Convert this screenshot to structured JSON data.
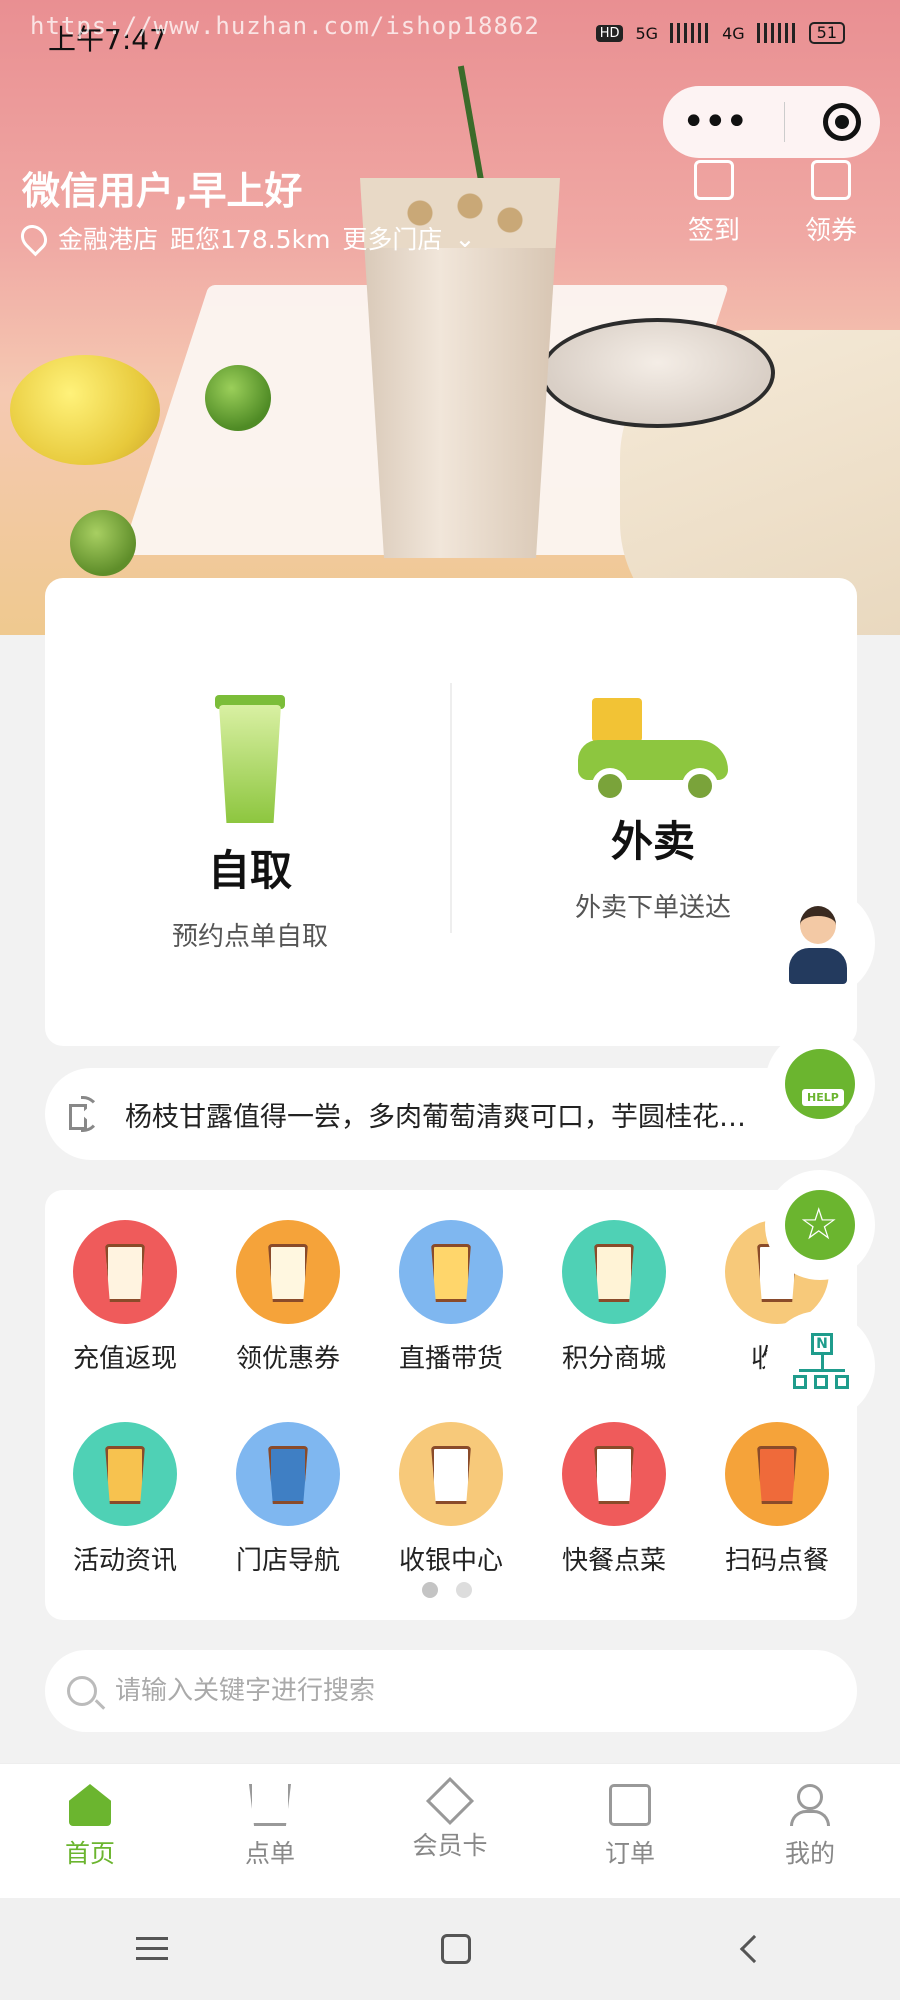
{
  "status_bar": {
    "time": "上午7:47",
    "network_5g": "5G",
    "network_4g": "4G",
    "hd": "HD",
    "battery": "51"
  },
  "watermark": "https://www.huzhan.com/ishop18862",
  "header": {
    "greeting": "微信用户,早上好",
    "store_name": "金融港店",
    "distance": "距您178.5km",
    "more_stores": "更多门店",
    "checkin_label": "签到",
    "coupon_label": "领券"
  },
  "order_options": [
    {
      "title": "自取",
      "subtitle": "预约点单自取",
      "icon": "pickup-cup-icon"
    },
    {
      "title": "外卖",
      "subtitle": "外卖下单送达",
      "icon": "delivery-scooter-icon"
    }
  ],
  "notice": {
    "text": "杨枝甘露值得一尝，多肉葡萄清爽可口，芋圆桂花…",
    "icon": "speaker-icon"
  },
  "grid": {
    "row1": [
      {
        "label": "充值返现",
        "color": "#ef5b5b"
      },
      {
        "label": "领优惠券",
        "color": "#f5a33a"
      },
      {
        "label": "直播带货",
        "color": "#7fb7f0"
      },
      {
        "label": "积分商城",
        "color": "#4fd1b5"
      },
      {
        "label": "收藏",
        "color": "#f7c97a"
      }
    ],
    "row2": [
      {
        "label": "活动资讯",
        "color": "#4fd1b5"
      },
      {
        "label": "门店导航",
        "color": "#7fb7f0"
      },
      {
        "label": "收银中心",
        "color": "#f7c97a"
      },
      {
        "label": "快餐点菜",
        "color": "#ef5b5b"
      },
      {
        "label": "扫码点餐",
        "color": "#f5a33a"
      }
    ]
  },
  "search": {
    "placeholder": "请输入关键字进行搜索"
  },
  "floating": {
    "help_badge": "HELP",
    "nav_letter": "N"
  },
  "tabbar": [
    {
      "label": "首页",
      "active": true
    },
    {
      "label": "点单",
      "active": false
    },
    {
      "label": "会员卡",
      "active": false
    },
    {
      "label": "订单",
      "active": false
    },
    {
      "label": "我的",
      "active": false
    }
  ],
  "colors": {
    "accent": "#6bb52f",
    "background": "#f2f2f2"
  }
}
